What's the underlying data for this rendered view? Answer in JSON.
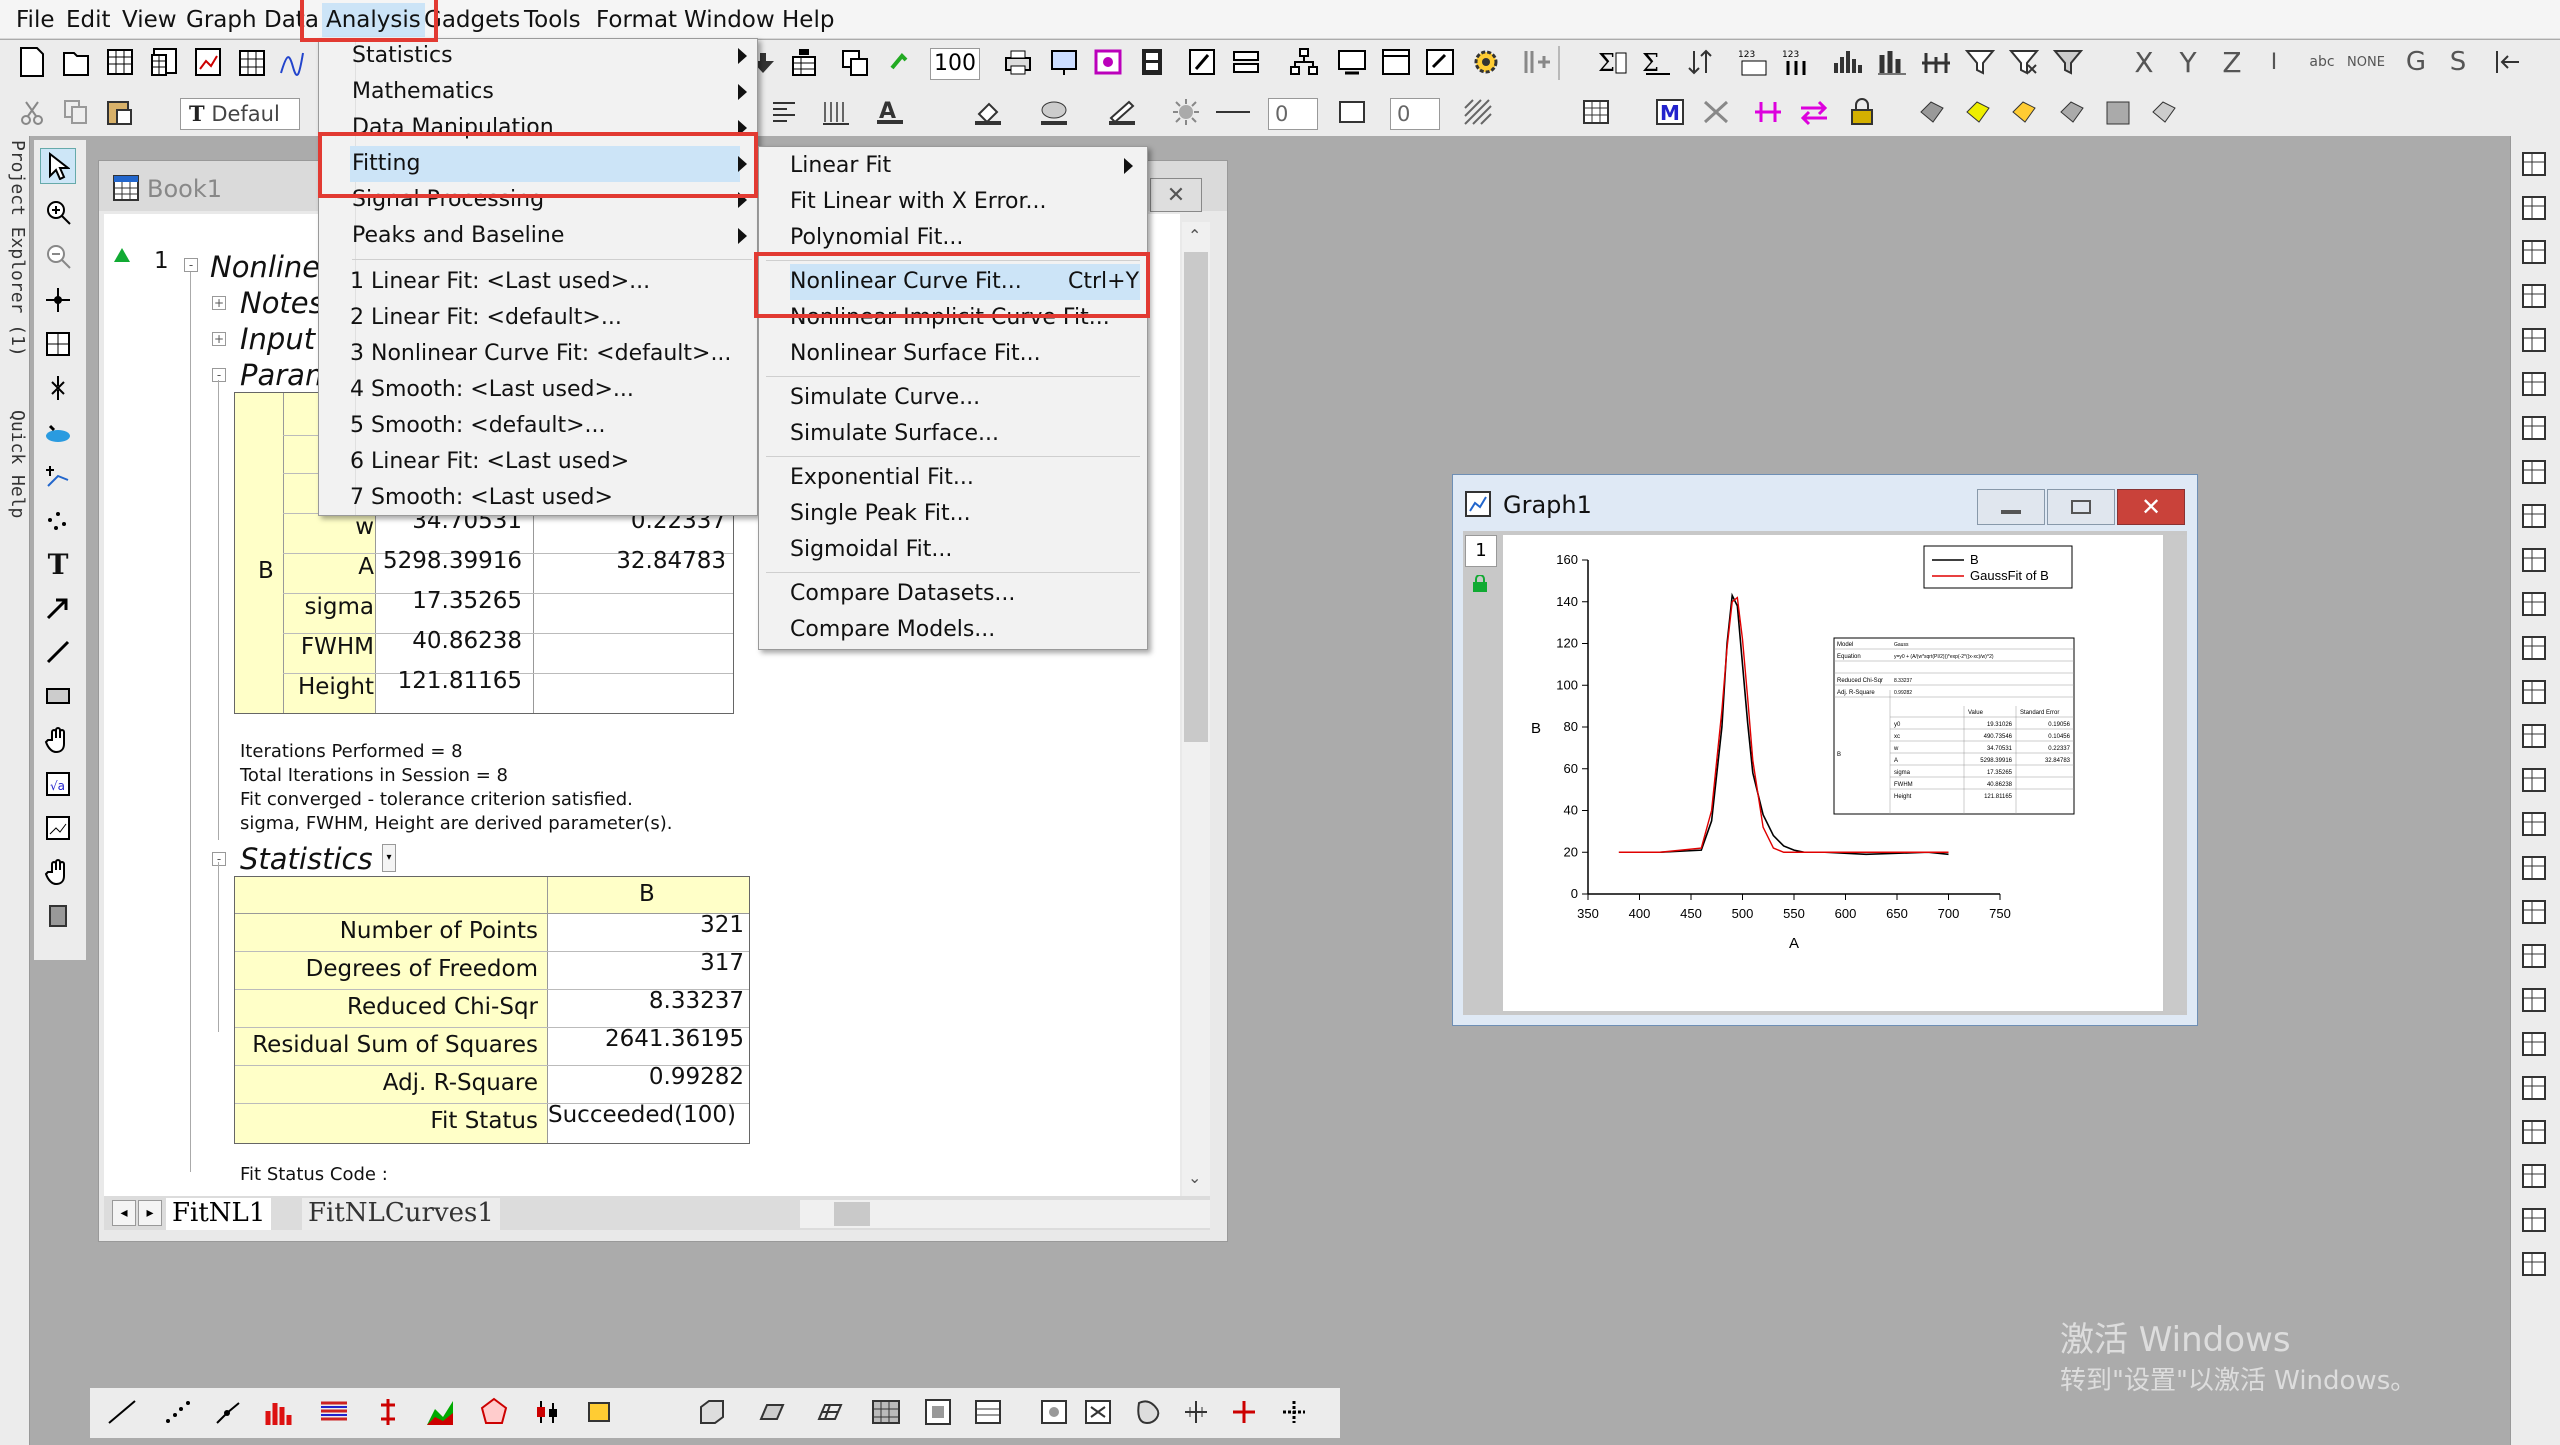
{
  "menubar": [
    "File",
    "Edit",
    "View",
    "Graph",
    "Data",
    "Analysis",
    "Gadgets",
    "Tools",
    "Format",
    "Window",
    "Help"
  ],
  "toolbar": {
    "zoom_value": "100",
    "font_name": "Defaul",
    "line_width": "0",
    "fill_width": "0"
  },
  "left_panel": {
    "project_explorer": "Project Explorer (1)",
    "quick_help": "Quick Help"
  },
  "analysis_menu": {
    "items": [
      "Statistics",
      "Mathematics",
      "Data Manipulation",
      "Fitting",
      "Signal Processing",
      "Peaks and Baseline"
    ],
    "recent": [
      "1 Linear Fit: <Last used>...",
      "2 Linear Fit: <default>...",
      "3 Nonlinear Curve Fit: <default>...",
      "4 Smooth: <Last used>...",
      "5 Smooth: <default>...",
      "6 Linear Fit: <Last used>",
      "7 Smooth: <Last used>"
    ]
  },
  "fitting_menu": {
    "group1": [
      "Linear Fit",
      "Fit Linear with X Error...",
      "Polynomial Fit..."
    ],
    "group2": [
      "Nonlinear Curve Fit...",
      "Nonlinear Implicit Curve Fit...",
      "Nonlinear Surface Fit..."
    ],
    "shortcut": "Ctrl+Y",
    "group3": [
      "Simulate Curve...",
      "Simulate Surface..."
    ],
    "group4": [
      "Exponential Fit...",
      "Single Peak Fit...",
      "Sigmoidal Fit..."
    ],
    "group5": [
      "Compare Datasets...",
      "Compare Models..."
    ]
  },
  "book": {
    "title": "Book1",
    "row_number": "1",
    "report_title": "Nonlinea",
    "tree": [
      "Notes",
      "Input D",
      "Param"
    ],
    "params": [
      {
        "label": "w",
        "value": "34.70531",
        "error": "0.22337"
      },
      {
        "label": "A",
        "value": "5298.39916",
        "error": "32.84783"
      },
      {
        "label": "sigma",
        "value": "17.35265",
        "error": ""
      },
      {
        "label": "FWHM",
        "value": "40.86238",
        "error": ""
      },
      {
        "label": "Height",
        "value": "121.81165",
        "error": ""
      }
    ],
    "params_group": "B",
    "notes": [
      "Iterations Performed = 8",
      "Total Iterations in Session = 8",
      "Fit converged - tolerance criterion satisfied.",
      "sigma, FWHM, Height are derived parameter(s)."
    ],
    "statistics_title": "Statistics",
    "stats_header": "B",
    "stats": [
      {
        "label": "Number of Points",
        "value": "321"
      },
      {
        "label": "Degrees of Freedom",
        "value": "317"
      },
      {
        "label": "Reduced Chi-Sqr",
        "value": "8.33237"
      },
      {
        "label": "Residual Sum of Squares",
        "value": "2641.36195"
      },
      {
        "label": "Adj. R-Square",
        "value": "0.99282"
      },
      {
        "label": "Fit Status",
        "value": "Succeeded(100)"
      }
    ],
    "fit_status_code": "Fit Status Code :",
    "tabs": [
      "FitNL1",
      "FitNLCurves1"
    ]
  },
  "graph": {
    "title": "Graph1",
    "layer": "1",
    "xlabel": "A",
    "ylabel": "B",
    "legend": [
      "B",
      "GaussFit of B"
    ]
  },
  "chart_data": {
    "type": "line",
    "xlabel": "A",
    "ylabel": "B",
    "xlim": [
      350,
      750
    ],
    "ylim": [
      0,
      160
    ],
    "xticks": [
      350,
      400,
      450,
      500,
      550,
      600,
      650,
      700,
      750
    ],
    "yticks": [
      0,
      20,
      40,
      60,
      80,
      100,
      120,
      140,
      160
    ],
    "series": [
      {
        "name": "B",
        "color": "#000000",
        "x": [
          380,
          420,
          460,
          470,
          480,
          485,
          490,
          495,
          500,
          505,
          510,
          520,
          530,
          540,
          550,
          560,
          580,
          620,
          680,
          700
        ],
        "y": [
          20,
          20,
          21,
          35,
          80,
          120,
          143,
          138,
          110,
          82,
          58,
          38,
          28,
          23,
          21,
          20,
          20,
          19,
          20,
          19
        ]
      },
      {
        "name": "GaussFit of B",
        "color": "#e00000",
        "x": [
          380,
          420,
          460,
          470,
          480,
          485,
          490,
          495,
          500,
          505,
          510,
          520,
          530,
          540,
          550,
          560,
          580,
          620,
          680,
          700
        ],
        "y": [
          20,
          20,
          22,
          40,
          88,
          118,
          140,
          142,
          122,
          94,
          64,
          32,
          22,
          20,
          20,
          20,
          20,
          20,
          20,
          20
        ]
      }
    ],
    "inset_table": {
      "rows": [
        "Model",
        "Equation",
        "Reduced Chi-Sqr",
        "Adj. R-Square"
      ],
      "model": "Gauss",
      "equation": "y=y0 + (A/(w*sqrt(PI/2)))*exp(-2*((x-xc)/w)^2)",
      "reduced_chi": "8.33237",
      "adj_r": "0.99282",
      "params": [
        "y0",
        "xc",
        "w",
        "A",
        "sigma",
        "FWHM",
        "Height"
      ],
      "values": [
        "19.31026",
        "490.73546",
        "34.70531",
        "5298.39916",
        "17.35265",
        "40.86238",
        "121.81165"
      ],
      "errors": [
        "0.19056",
        "0.10456",
        "0.22337",
        "32.84783",
        "",
        "",
        ""
      ],
      "value_header": "Value",
      "error_header": "Standard Error",
      "group": "B"
    }
  },
  "watermark": {
    "line1": "激活 Windows",
    "line2": "转到\"设置\"以激活 Windows。"
  }
}
